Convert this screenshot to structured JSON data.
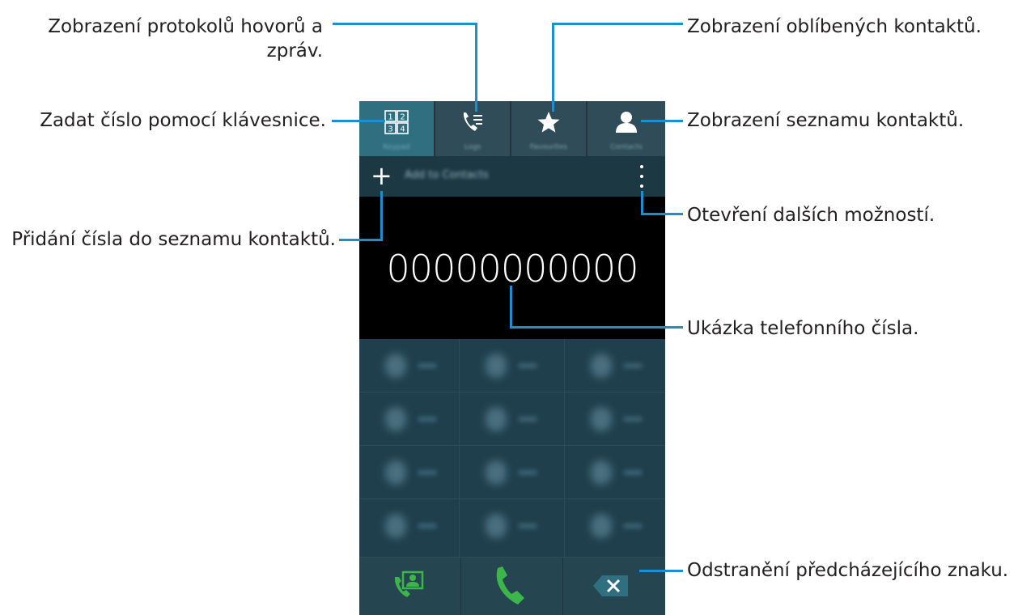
{
  "callouts": {
    "call_logs": "Zobrazení protokolů hovorů a",
    "call_logs_2": "zpráv.",
    "favorites": "Zobrazení oblíbených kontaktů.",
    "keypad": "Zadat číslo pomocí klávesnice.",
    "contacts": "Zobrazení seznamu kontaktů.",
    "more_options": "Otevření dalších možností.",
    "add_contact": "Přidání čísla do seznamu kontaktů.",
    "number_preview": "Ukázka telefonního čísla.",
    "delete_char": "Odstranění předcházejícího znaku."
  },
  "phone": {
    "tabs": [
      {
        "icon": "keypad-icon",
        "label": "Keypad",
        "active": true
      },
      {
        "icon": "call-logs-icon",
        "label": "Logs",
        "active": false
      },
      {
        "icon": "star-icon",
        "label": "Favourites",
        "active": false
      },
      {
        "icon": "person-icon",
        "label": "Contacts",
        "active": false
      }
    ],
    "action_bar": {
      "plus": "+",
      "add_label": "Add to Contacts"
    },
    "number": "00000000000",
    "bottom_buttons": [
      "contact-card-icon",
      "phone-icon",
      "backspace-icon"
    ],
    "colors": {
      "accent": "#1d8fd0",
      "call_green": "#3cb54a",
      "tab_active": "#2f6f80"
    }
  }
}
